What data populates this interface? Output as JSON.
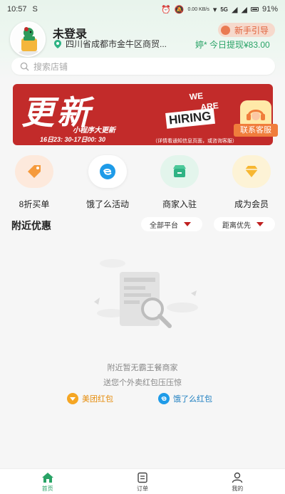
{
  "status_bar": {
    "time": "10:57",
    "notification_icon": "S",
    "signal_text": "5G",
    "battery": "91%",
    "data_speed": "0.00 KB/s"
  },
  "header": {
    "login_title": "未登录",
    "location": "四川省成都市金牛区商贸...",
    "guide_label": "新手引导",
    "withdraw_text": "婷* 今日提现¥83.00"
  },
  "search": {
    "placeholder": "搜索店铺"
  },
  "banner": {
    "headline": "更新",
    "hiring_line1": "WE",
    "hiring_line2": "ARE",
    "hiring_line3": "HIRING",
    "subtitle": "小程序大更新",
    "date_line": "16日23: 30-17日00: 30",
    "note": "（详情看通知信息页面，或咨询客服）"
  },
  "service": {
    "label": "联系客服"
  },
  "actions": [
    {
      "label": "8折买单",
      "icon": "discount-tag-icon",
      "color": "#f59a3c",
      "bg": "#fde9dc"
    },
    {
      "label": "饿了么活动",
      "icon": "eleme-icon",
      "color": "#1e9be8",
      "bg": "#ffffff"
    },
    {
      "label": "商家入驻",
      "icon": "store-icon",
      "color": "#2fb384",
      "bg": "#e3f5ec"
    },
    {
      "label": "成为会员",
      "icon": "diamond-icon",
      "color": "#f7b731",
      "bg": "#fdf3d6"
    }
  ],
  "nearby": {
    "title": "附近优惠",
    "filter_platform": "全部平台",
    "filter_sort": "距离优先"
  },
  "empty_state": {
    "line1": "附近暂无霸王餐商家",
    "line2": "送您个外卖红包压压惊",
    "meituan_label": "美团红包",
    "eleme_label": "饿了么红包",
    "meituan_color": "#f5a623",
    "eleme_color": "#1e9be8"
  },
  "bottom_nav": [
    {
      "label": "首页",
      "icon": "home-icon",
      "active": true
    },
    {
      "label": "订单",
      "icon": "order-icon",
      "active": false
    },
    {
      "label": "我的",
      "icon": "profile-icon",
      "active": false
    }
  ],
  "colors": {
    "accent": "#29a366",
    "banner_red": "#c22b2a",
    "guide_orange": "#e0623b"
  }
}
